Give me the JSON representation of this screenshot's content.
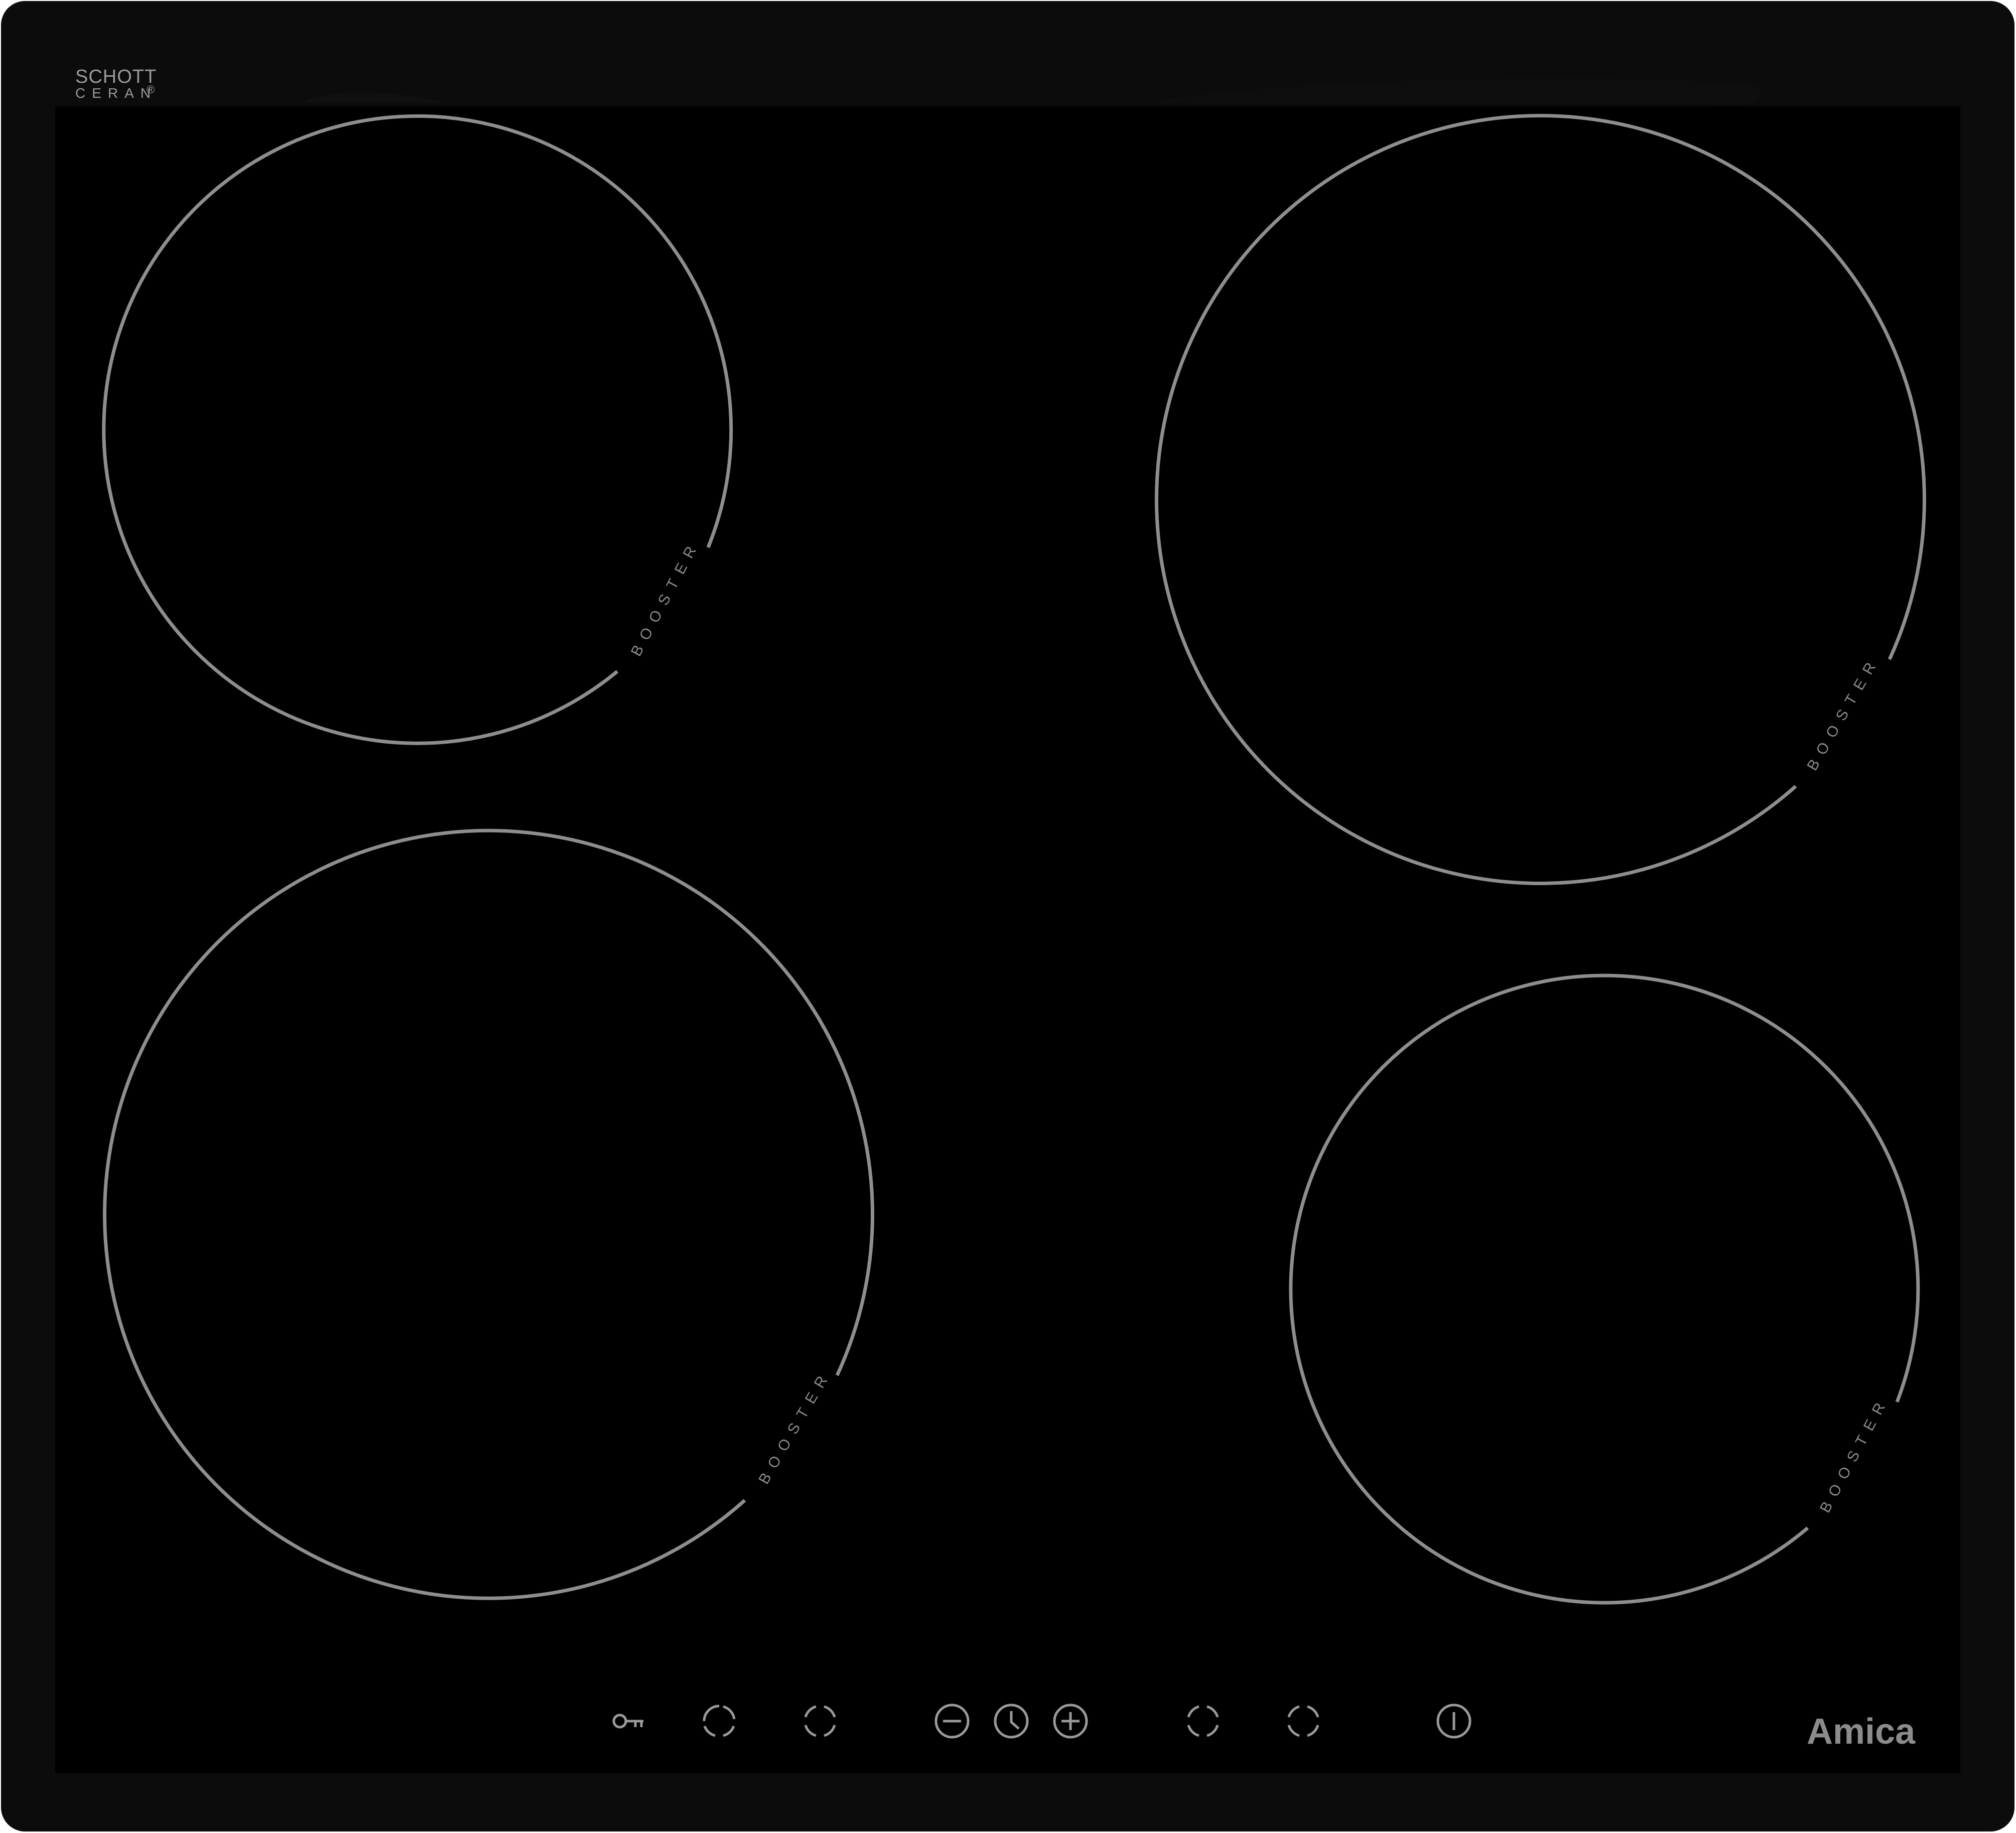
{
  "appliance": {
    "type": "ceramic hob",
    "frame_color": "#0c0c0c",
    "glass_color": "#000000",
    "ring_color": "#8e8e8e"
  },
  "badge": {
    "line1": "SCHOTT",
    "line2": "CERAN",
    "registered": "®"
  },
  "brand": {
    "name": "Amica"
  },
  "zones": [
    {
      "id": "rear-left",
      "label": "BOOSTER"
    },
    {
      "id": "rear-right",
      "label": "BOOSTER"
    },
    {
      "id": "front-left",
      "label": "BOOSTER"
    },
    {
      "id": "front-right",
      "label": "BOOSTER"
    }
  ],
  "controls": [
    {
      "id": "key-lock",
      "icon": "key-icon"
    },
    {
      "id": "zone-select-1",
      "icon": "zone-select-icon"
    },
    {
      "id": "zone-select-2",
      "icon": "zone-select-icon"
    },
    {
      "id": "minus",
      "icon": "minus-icon"
    },
    {
      "id": "timer",
      "icon": "clock-icon"
    },
    {
      "id": "plus",
      "icon": "plus-icon"
    },
    {
      "id": "zone-select-3",
      "icon": "zone-select-icon"
    },
    {
      "id": "zone-select-4",
      "icon": "zone-select-icon"
    },
    {
      "id": "power",
      "icon": "power-icon"
    }
  ]
}
